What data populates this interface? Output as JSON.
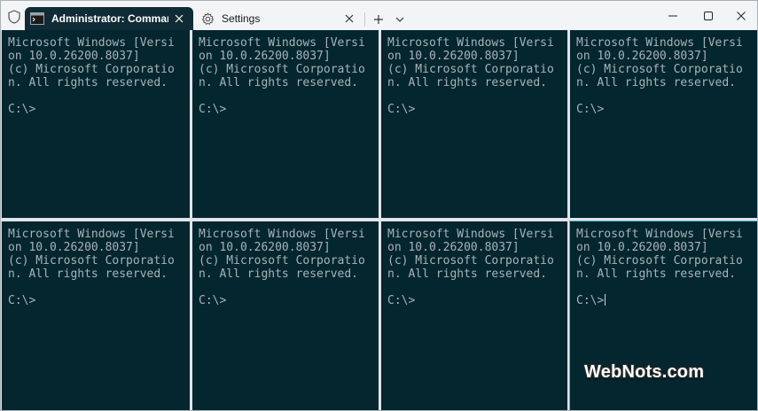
{
  "tabs": [
    {
      "label": "Administrator: Command P",
      "icon": "cmd-icon",
      "active": true
    },
    {
      "label": "Settings",
      "icon": "gear-icon",
      "active": false
    }
  ],
  "toolbar": {
    "new_tab": "+",
    "dropdown": "chevron-down-icon"
  },
  "window_controls": [
    "minimize-icon",
    "maximize-icon",
    "close-icon"
  ],
  "panes": [
    {
      "lines": [
        "Microsoft Windows [Versi",
        "on 10.0.26200.8037]",
        "(c) Microsoft Corporatio",
        "n. All rights reserved.",
        "",
        "C:\\>"
      ]
    },
    {
      "lines": [
        "Microsoft Windows [Versi",
        "on 10.0.26200.8037]",
        "(c) Microsoft Corporatio",
        "n. All rights reserved.",
        "",
        "C:\\>"
      ]
    },
    {
      "lines": [
        "Microsoft Windows [Versi",
        "on 10.0.26200.8037]",
        "(c) Microsoft Corporatio",
        "n. All rights reserved.",
        "",
        "C:\\>"
      ]
    },
    {
      "lines": [
        "Microsoft Windows [Versi",
        "on 10.0.26200.8037]",
        "(c) Microsoft Corporatio",
        "n. All rights reserved.",
        "",
        "C:\\>"
      ]
    },
    {
      "lines": [
        "Microsoft Windows [Versi",
        "on 10.0.26200.8037]",
        "(c) Microsoft Corporatio",
        "n. All rights reserved.",
        "",
        "C:\\>"
      ]
    },
    {
      "lines": [
        "Microsoft Windows [Versi",
        "on 10.0.26200.8037]",
        "(c) Microsoft Corporatio",
        "n. All rights reserved.",
        "",
        "C:\\>"
      ]
    },
    {
      "lines": [
        "Microsoft Windows [Versi",
        "on 10.0.26200.8037]",
        "(c) Microsoft Corporatio",
        "n. All rights reserved.",
        "",
        "C:\\>"
      ]
    },
    {
      "lines": [
        "Microsoft Windows [Versi",
        "on 10.0.26200.8037]",
        "(c) Microsoft Corporatio",
        "n. All rights reserved.",
        "",
        "C:\\>"
      ]
    }
  ],
  "watermark": "WebNots.com",
  "colors": {
    "terminal_bg": "#04262f",
    "terminal_text": "#a8b4b8",
    "focus_border": "#49c0d6",
    "divider": "#dfe4e7"
  }
}
